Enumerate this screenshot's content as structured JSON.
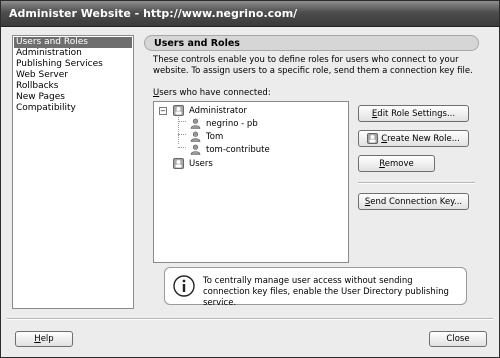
{
  "window": {
    "title": "Administer Website - http://www.negrino.com/"
  },
  "sidebar": {
    "items": [
      {
        "label": "Users and Roles",
        "selected": true
      },
      {
        "label": "Administration",
        "selected": false
      },
      {
        "label": "Publishing Services",
        "selected": false
      },
      {
        "label": "Web Server",
        "selected": false
      },
      {
        "label": "Rollbacks",
        "selected": false
      },
      {
        "label": "New Pages",
        "selected": false
      },
      {
        "label": "Compatibility",
        "selected": false
      }
    ]
  },
  "panel": {
    "title": "Users and Roles",
    "description": "These controls enable you to define roles for users who connect to your website. To assign users to a specific role, send them a connection key file.",
    "users_label_hotkey": "U",
    "users_label_rest": "sers who have connected:",
    "tree": {
      "expander": "−",
      "groups": [
        {
          "label": "Administrator",
          "icon": "group-icon"
        },
        {
          "label": "Users",
          "icon": "group-icon"
        }
      ],
      "members": [
        {
          "label": "negrino - pb",
          "icon": "user-icon"
        },
        {
          "label": "Tom",
          "icon": "user-icon"
        },
        {
          "label": "tom-contribute",
          "icon": "user-icon"
        }
      ]
    }
  },
  "buttons": {
    "edit_role_hotkey": "E",
    "edit_role_rest": "dit Role Settings...",
    "create_role_hotkey": "C",
    "create_role_rest": "reate New Role...",
    "remove_hotkey": "R",
    "remove_rest": "emove",
    "send_key_hotkey": "S",
    "send_key_rest": "end Connection Key...",
    "help_hotkey": "H",
    "help_rest": "elp",
    "close": "Close"
  },
  "info": {
    "icon": "info-icon",
    "text": "To centrally manage user access without sending connection key files, enable the User Directory publishing service."
  },
  "colors": {
    "titlebar": "#4e4e4e",
    "selection": "#6e6e6e",
    "dialog_bg": "#ececec"
  }
}
